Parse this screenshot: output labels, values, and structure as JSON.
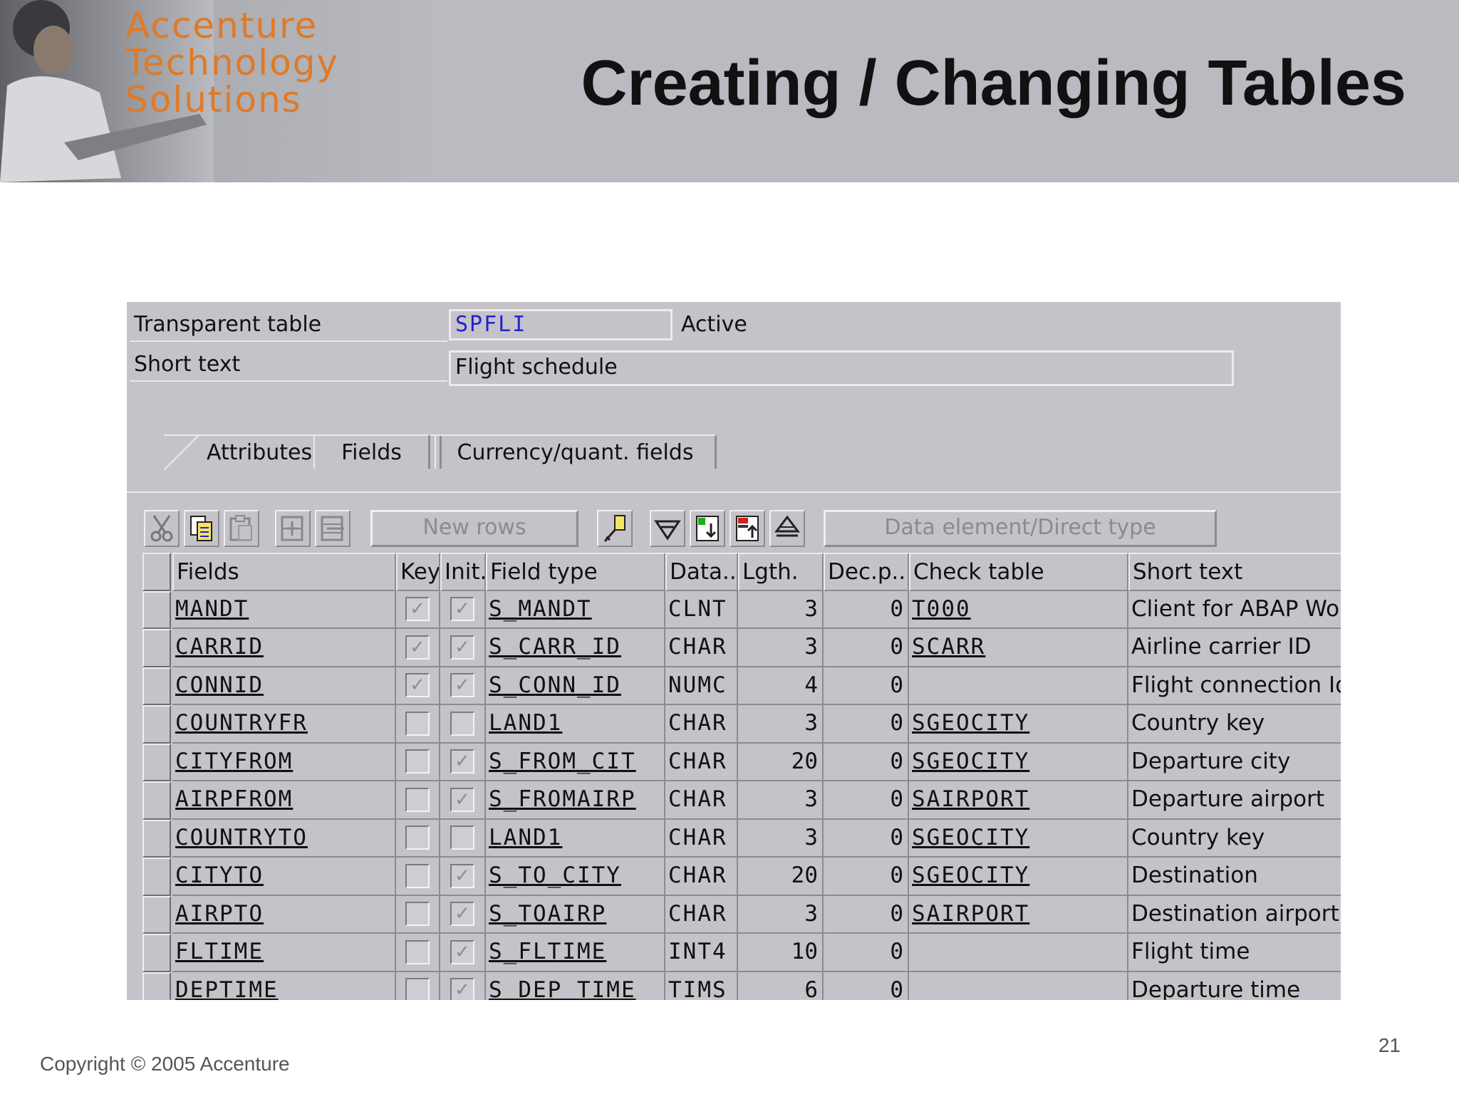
{
  "header": {
    "brand_lines": [
      "Accenture",
      "Technology",
      "Solutions"
    ],
    "title": "Creating / Changing Tables"
  },
  "sap": {
    "table_label": "Transparent table",
    "table_name": "SPFLI",
    "status": "Active",
    "short_text_label": "Short text",
    "short_text": "Flight schedule",
    "tabs": [
      "Attributes",
      "Fields",
      "Currency/quant. fields"
    ],
    "active_tab": "Fields",
    "toolbar": {
      "new_rows": "New rows",
      "data_element": "Data element/Direct type",
      "icons": [
        "cut-icon",
        "copy-icon",
        "paste-icon",
        "insert-row-icon",
        "delete-row-icon",
        "key-icon",
        "search-help-icon",
        "append-structure-icon",
        "include-icon",
        "hierarchy-icon"
      ]
    },
    "columns": [
      "Fields",
      "Key",
      "Init.",
      "Field type",
      "Data...",
      "Lgth.",
      "Dec.p...",
      "Check table",
      "Short text"
    ],
    "rows": [
      {
        "field": "MANDT",
        "key": true,
        "init": true,
        "type": "S_MANDT",
        "data": "CLNT",
        "len": "3",
        "dec": "0",
        "check": "T000",
        "text": "Client for ABAP Work"
      },
      {
        "field": "CARRID",
        "key": true,
        "init": true,
        "type": "S_CARR_ID",
        "data": "CHAR",
        "len": "3",
        "dec": "0",
        "check": "SCARR",
        "text": "Airline carrier ID"
      },
      {
        "field": "CONNID",
        "key": true,
        "init": true,
        "type": "S_CONN_ID",
        "data": "NUMC",
        "len": "4",
        "dec": "0",
        "check": "",
        "text": "Flight connection Id"
      },
      {
        "field": "COUNTRYFR",
        "key": false,
        "init": false,
        "type": "LAND1",
        "data": "CHAR",
        "len": "3",
        "dec": "0",
        "check": "SGEOCITY",
        "text": "Country key"
      },
      {
        "field": "CITYFROM",
        "key": false,
        "init": true,
        "type": "S_FROM_CIT",
        "data": "CHAR",
        "len": "20",
        "dec": "0",
        "check": "SGEOCITY",
        "text": "Departure city"
      },
      {
        "field": "AIRPFROM",
        "key": false,
        "init": true,
        "type": "S_FROMAIRP",
        "data": "CHAR",
        "len": "3",
        "dec": "0",
        "check": "SAIRPORT",
        "text": "Departure airport"
      },
      {
        "field": "COUNTRYTO",
        "key": false,
        "init": false,
        "type": "LAND1",
        "data": "CHAR",
        "len": "3",
        "dec": "0",
        "check": "SGEOCITY",
        "text": "Country key"
      },
      {
        "field": "CITYTO",
        "key": false,
        "init": true,
        "type": "S_TO_CITY",
        "data": "CHAR",
        "len": "20",
        "dec": "0",
        "check": "SGEOCITY",
        "text": "Destination"
      },
      {
        "field": "AIRPTO",
        "key": false,
        "init": true,
        "type": "S_TOAIRP",
        "data": "CHAR",
        "len": "3",
        "dec": "0",
        "check": "SAIRPORT",
        "text": "Destination airport"
      },
      {
        "field": "FLTIME",
        "key": false,
        "init": true,
        "type": "S_FLTIME",
        "data": "INT4",
        "len": "10",
        "dec": "0",
        "check": "",
        "text": "Flight time"
      },
      {
        "field": "DEPTIME",
        "key": false,
        "init": true,
        "type": "S_DEP_TIME",
        "data": "TIMS",
        "len": "6",
        "dec": "0",
        "check": "",
        "text": "Departure time"
      }
    ]
  },
  "footer": {
    "copyright": "Copyright © 2005 Accenture",
    "page_number": "21"
  }
}
